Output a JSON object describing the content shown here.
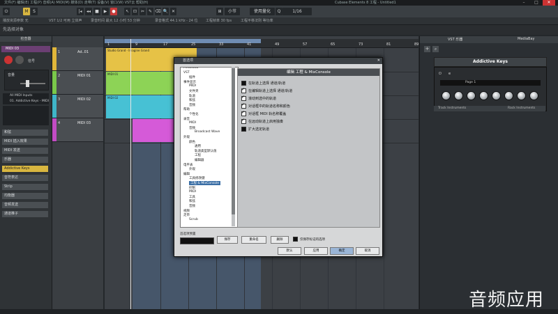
{
  "window": {
    "menu": "文件(F) 编辑(E) 工程(P) 音频(A) MIDI(M) 媒体(D) 走带(T) 设备(V) 窗口(W) VST云 帮助(H)",
    "caption": "Cubase Elements 8 工程 - Untitled1"
  },
  "toolbar": {
    "snap_label": "小节",
    "quantize_label": "1/16",
    "grid_label": "使用量化"
  },
  "infobar": {
    "items": [
      "播放资源参数 无",
      "VST 1/2 可用 立体声",
      "录音时间 最大 12 小时 53 分钟",
      "录音格式 44.1 kHz - 24 位",
      "工程帧率 30 fps",
      "工程平移法则 等功率"
    ]
  },
  "status": "先选择对象",
  "inspector": {
    "tab_label": "检查器",
    "track_name": "MIDI 03",
    "labels": [
      "信号",
      "音量"
    ],
    "routing": [
      "All MIDI Inputs",
      "01. Addictive Keys - MIDI"
    ],
    "sections": [
      {
        "label": "和弦",
        "highlight": false
      },
      {
        "label": "MIDI 插入效果",
        "highlight": false
      },
      {
        "label": "MIDI 发送",
        "highlight": false
      },
      {
        "label": "乐器",
        "highlight": false
      },
      {
        "label": "Addictive Keys",
        "highlight": true
      },
      {
        "label": "音符表达",
        "highlight": false
      },
      {
        "label": "Strip",
        "highlight": false
      },
      {
        "label": "均衡器",
        "highlight": false
      },
      {
        "label": "音频发送",
        "highlight": false
      },
      {
        "label": "通道推子",
        "highlight": false
      }
    ]
  },
  "tracks": [
    {
      "num": "1",
      "name": "Ad..01",
      "color": "#e0b63a",
      "height": 34
    },
    {
      "num": "2",
      "name": "MIDI 01",
      "color": "#7ac84a",
      "height": 34
    },
    {
      "num": "3",
      "name": "MIDI 02",
      "color": "#3fb5c8",
      "height": 34
    },
    {
      "num": "4",
      "name": "MIDI 03",
      "color": "#c24cc4",
      "height": 34
    }
  ],
  "ruler": {
    "ticks": [
      "1",
      "9",
      "17",
      "25",
      "33",
      "41",
      "49",
      "57",
      "65",
      "73",
      "81",
      "89"
    ]
  },
  "clips": [
    {
      "lane": 0,
      "start": 0,
      "width": 132,
      "color": "#e6c246",
      "label": "Studio Grand - Imagine Grand"
    },
    {
      "lane": 1,
      "start": 0,
      "width": 132,
      "color": "#8dd356",
      "label": "MIDI 01"
    },
    {
      "lane": 2,
      "start": 0,
      "width": 132,
      "color": "#47c1d4",
      "label": "MIDI 02"
    },
    {
      "lane": 3,
      "start": 40,
      "width": 92,
      "color": "#d55ad8",
      "label": ""
    }
  ],
  "right_panel": {
    "tab_vst": "VST 乐器",
    "tab_media": "MediaBay",
    "instrument": "Addictive Keys",
    "preset_label": "Page 1",
    "foot_left": "Track Instruments",
    "foot_right": "Rack Instruments"
  },
  "dialog": {
    "title": "首选项",
    "close": "✕",
    "tree": [
      {
        "label": "Metadata",
        "indent": 0,
        "selected": false
      },
      {
        "label": "VST",
        "indent": 0,
        "selected": false
      },
      {
        "label": "插件",
        "indent": 1,
        "selected": false
      },
      {
        "label": "事件显示",
        "indent": 0,
        "selected": false
      },
      {
        "label": "MIDI",
        "indent": 1,
        "selected": false
      },
      {
        "label": "文件夹",
        "indent": 1,
        "selected": false
      },
      {
        "label": "轨道",
        "indent": 1,
        "selected": false
      },
      {
        "label": "和弦",
        "indent": 1,
        "selected": false
      },
      {
        "label": "音频",
        "indent": 1,
        "selected": false
      },
      {
        "label": "帮助",
        "indent": 0,
        "selected": false
      },
      {
        "label": "个性化",
        "indent": 1,
        "selected": false
      },
      {
        "label": "录音",
        "indent": 0,
        "selected": false
      },
      {
        "label": "MIDI",
        "indent": 1,
        "selected": false
      },
      {
        "label": "音频",
        "indent": 1,
        "selected": false
      },
      {
        "label": "Broadcast Wave",
        "indent": 2,
        "selected": false
      },
      {
        "label": "外观",
        "indent": 0,
        "selected": false
      },
      {
        "label": "颜色",
        "indent": 1,
        "selected": false
      },
      {
        "label": "通用",
        "indent": 2,
        "selected": false
      },
      {
        "label": "轨道类型默认值",
        "indent": 2,
        "selected": false
      },
      {
        "label": "工程",
        "indent": 2,
        "selected": false
      },
      {
        "label": "编辑器",
        "indent": 2,
        "selected": false
      },
      {
        "label": "电平表",
        "indent": 0,
        "selected": false
      },
      {
        "label": "外观",
        "indent": 1,
        "selected": false
      },
      {
        "label": "编辑",
        "indent": 0,
        "selected": false
      },
      {
        "label": "工具修改键",
        "indent": 1,
        "selected": false
      },
      {
        "label": "工程 & MixConsole",
        "indent": 1,
        "selected": true
      },
      {
        "label": "控制",
        "indent": 1,
        "selected": false
      },
      {
        "label": "MIDI",
        "indent": 1,
        "selected": false
      },
      {
        "label": "工具",
        "indent": 1,
        "selected": false
      },
      {
        "label": "和弦",
        "indent": 1,
        "selected": false
      },
      {
        "label": "音频",
        "indent": 1,
        "selected": false
      },
      {
        "label": "视频",
        "indent": 0,
        "selected": false
      },
      {
        "label": "走带",
        "indent": 0,
        "selected": false
      },
      {
        "label": "Scrub",
        "indent": 1,
        "selected": false
      }
    ],
    "pane_title": "编辑 工程 & MixConsole",
    "options": [
      {
        "label": "在轨道上选择 通道/轨道",
        "checked": false
      },
      {
        "label": "在编辑轨道上选择 通道/轨道",
        "checked": true
      },
      {
        "label": "滚动到选中的轨道",
        "checked": true
      },
      {
        "label": "对话框中的轨道名称和颜色",
        "checked": true
      },
      {
        "label": "对话框 MIDI 轨名称覆盖",
        "checked": true
      },
      {
        "label": "在远动轨道上启用独奏",
        "checked": true
      },
      {
        "label": "扩大选定轨道",
        "checked": false
      }
    ],
    "preset_caption": "首选项预置",
    "btn_save": "保存",
    "btn_rename": "重命名",
    "btn_delete": "删除",
    "only_checked": "仅保存标记的选项",
    "btn_default": "默认",
    "btn_apply": "应用",
    "btn_ok": "确定",
    "btn_cancel": "取消"
  },
  "watermark": "音频应用"
}
